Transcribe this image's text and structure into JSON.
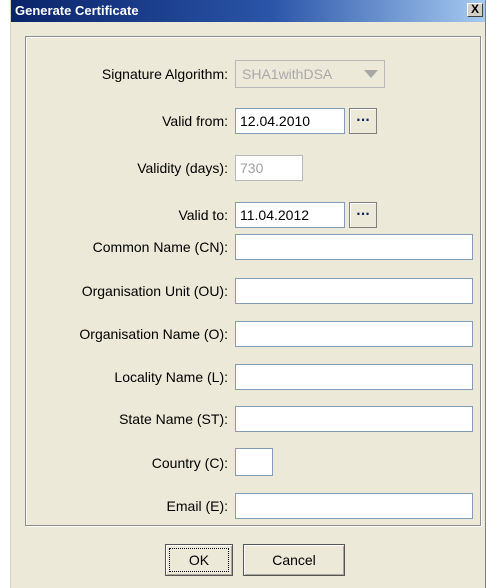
{
  "window": {
    "title": "Generate Certificate",
    "close_label": "X"
  },
  "form": {
    "signature_algorithm": {
      "label": "Signature Algorithm:",
      "value": "SHA1withDSA"
    },
    "valid_from": {
      "label": "Valid from:",
      "value": "12.04.2010",
      "picker": "···"
    },
    "validity_days": {
      "label": "Validity (days):",
      "value": "730"
    },
    "valid_to": {
      "label": "Valid to:",
      "value": "11.04.2012",
      "picker": "···"
    },
    "common_name": {
      "label": "Common Name (CN):",
      "value": ""
    },
    "org_unit": {
      "label": "Organisation Unit (OU):",
      "value": ""
    },
    "org_name": {
      "label": "Organisation Name (O):",
      "value": ""
    },
    "locality": {
      "label": "Locality Name (L):",
      "value": ""
    },
    "state": {
      "label": "State Name (ST):",
      "value": ""
    },
    "country": {
      "label": "Country (C):",
      "value": ""
    },
    "email": {
      "label": "Email (E):",
      "value": ""
    }
  },
  "buttons": {
    "ok": "OK",
    "cancel": "Cancel"
  }
}
